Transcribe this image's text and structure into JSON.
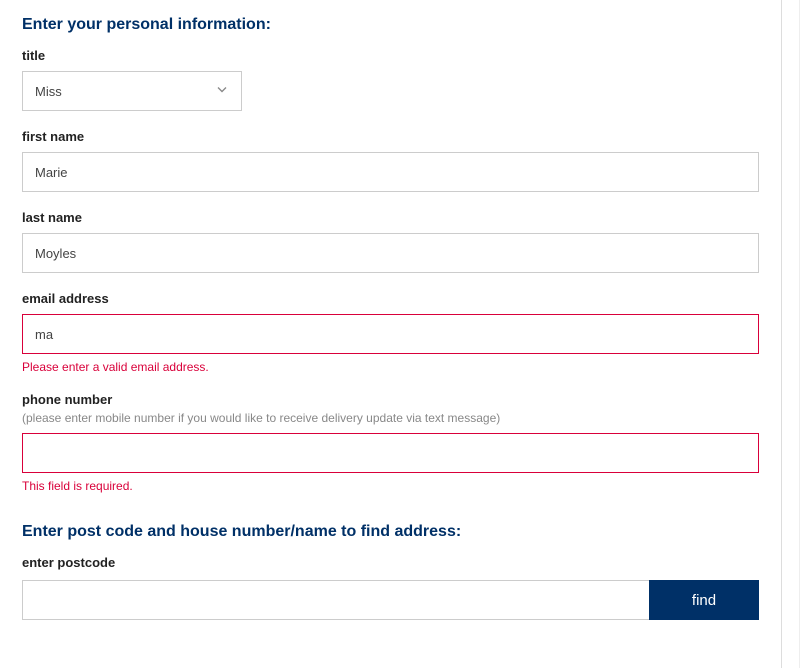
{
  "personal": {
    "section_title": "Enter your personal information:",
    "title": {
      "label": "title",
      "value": "Miss"
    },
    "first_name": {
      "label": "first name",
      "value": "Marie"
    },
    "last_name": {
      "label": "last name",
      "value": "Moyles"
    },
    "email": {
      "label": "email address",
      "value": "ma",
      "error": "Please enter a valid email address."
    },
    "phone": {
      "label": "phone number",
      "hint": "(please enter mobile number if you would like to receive delivery update via text message)",
      "value": "",
      "error": "This field is required."
    }
  },
  "address": {
    "section_title": "Enter post code and house number/name to find address:",
    "postcode": {
      "label": "enter postcode",
      "value": ""
    },
    "find_label": "find"
  }
}
